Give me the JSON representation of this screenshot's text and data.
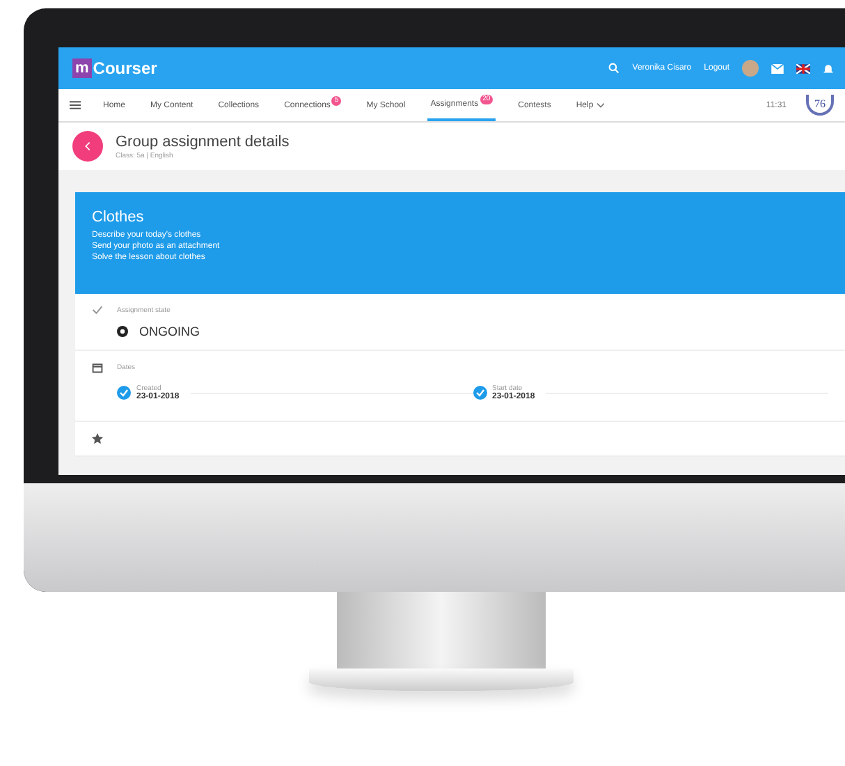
{
  "app": {
    "logo_mark": "m",
    "logo_text": "Courser",
    "user": "Veronika Cisaro",
    "logout": "Logout"
  },
  "nav": [
    {
      "label": "Home",
      "selected": false
    },
    {
      "label": "My Content",
      "selected": false
    },
    {
      "label": "Collections",
      "selected": false
    },
    {
      "label": "Connections",
      "selected": false,
      "badge": "5"
    },
    {
      "label": "My School",
      "selected": false
    },
    {
      "label": "Assignments",
      "selected": true,
      "badge": "20"
    },
    {
      "label": "Contests",
      "selected": false
    },
    {
      "label": "Help",
      "selected": false,
      "dropdown": true
    }
  ],
  "time": "11:31",
  "level_badge": "76",
  "header": {
    "title": "Group assignment details",
    "subtitle": "Class: 5a | English"
  },
  "card": {
    "title": "Clothes",
    "lines": [
      "Describe your today's clothes",
      "Send your photo as an attachment",
      "Solve the lesson about clothes"
    ]
  },
  "state": {
    "label": "Assignment state",
    "value": "ONGOING"
  },
  "dates": {
    "label": "Dates",
    "items": [
      {
        "label": "Created",
        "value": "23-01-2018",
        "done": true
      },
      {
        "label": "Start date",
        "value": "23-01-2018",
        "done": true
      }
    ]
  }
}
